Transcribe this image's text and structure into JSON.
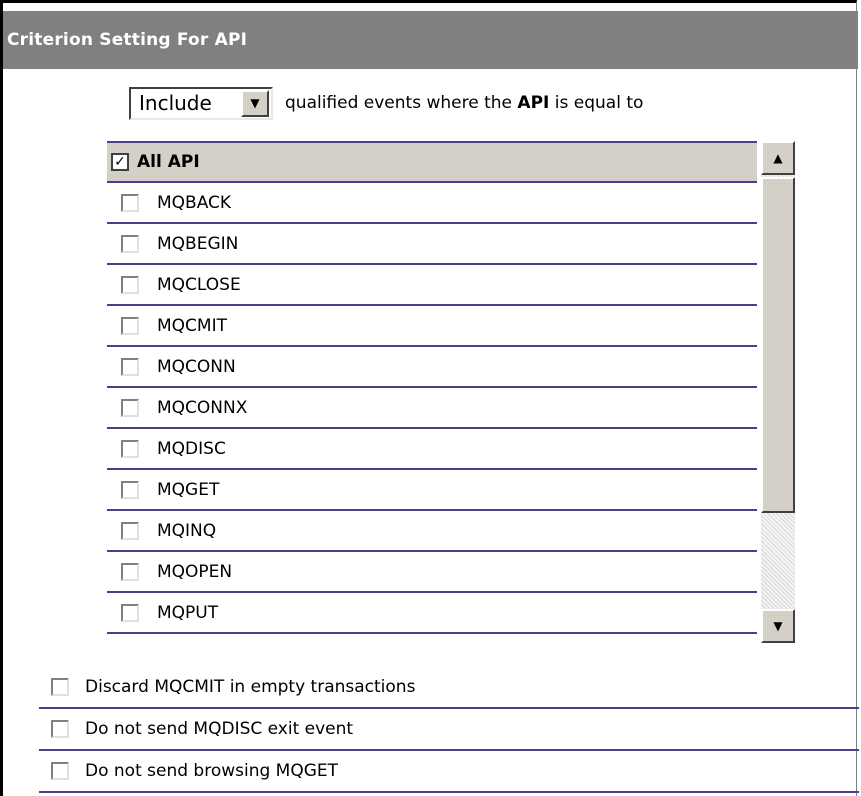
{
  "panel": {
    "title": "Criterion Setting For API"
  },
  "filter": {
    "mode_value": "Include",
    "text_prefix": "qualified events where the",
    "text_bold": "API",
    "text_suffix": "is equal to"
  },
  "api_list": {
    "header": {
      "label": "All API",
      "checked": true
    },
    "items": [
      {
        "label": "MQBACK",
        "checked": false
      },
      {
        "label": "MQBEGIN",
        "checked": false
      },
      {
        "label": "MQCLOSE",
        "checked": false
      },
      {
        "label": "MQCMIT",
        "checked": false
      },
      {
        "label": "MQCONN",
        "checked": false
      },
      {
        "label": "MQCONNX",
        "checked": false
      },
      {
        "label": "MQDISC",
        "checked": false
      },
      {
        "label": "MQGET",
        "checked": false
      },
      {
        "label": "MQINQ",
        "checked": false
      },
      {
        "label": "MQOPEN",
        "checked": false
      },
      {
        "label": "MQPUT",
        "checked": false
      }
    ]
  },
  "options": [
    {
      "label": "Discard MQCMIT in empty transactions",
      "checked": false
    },
    {
      "label": "Do not send MQDISC exit event",
      "checked": false
    },
    {
      "label": "Do not send browsing MQGET",
      "checked": false
    }
  ],
  "icons": {
    "dropdown": "chevron-down-icon",
    "scroll_up": "arrow-up-icon",
    "scroll_down": "arrow-down-icon",
    "check": "checkmark-icon"
  },
  "colors": {
    "title_bg": "#808080",
    "row_divider": "#4b3f8c",
    "header_bg": "#d4d0c8"
  }
}
